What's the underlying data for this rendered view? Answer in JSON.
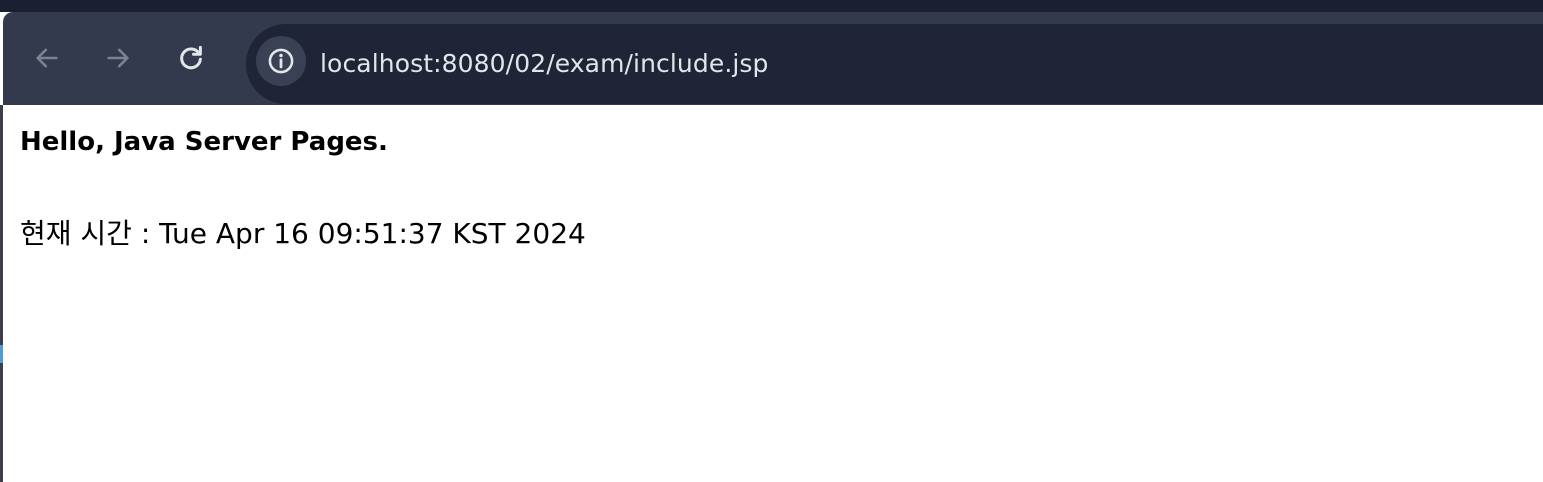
{
  "browser": {
    "back_icon": "arrow-left-icon",
    "forward_icon": "arrow-right-icon",
    "reload_icon": "reload-icon",
    "site_info_icon": "info-icon",
    "url": "localhost:8080/02/exam/include.jsp",
    "colors": {
      "frame": "#343a4d",
      "omnibox": "#1f2436",
      "url_text": "#e3e5ea"
    }
  },
  "page": {
    "heading": "Hello, Java Server Pages.",
    "time_label": "현재 시간 : Tue Apr 16 09:51:37 KST 2024"
  }
}
